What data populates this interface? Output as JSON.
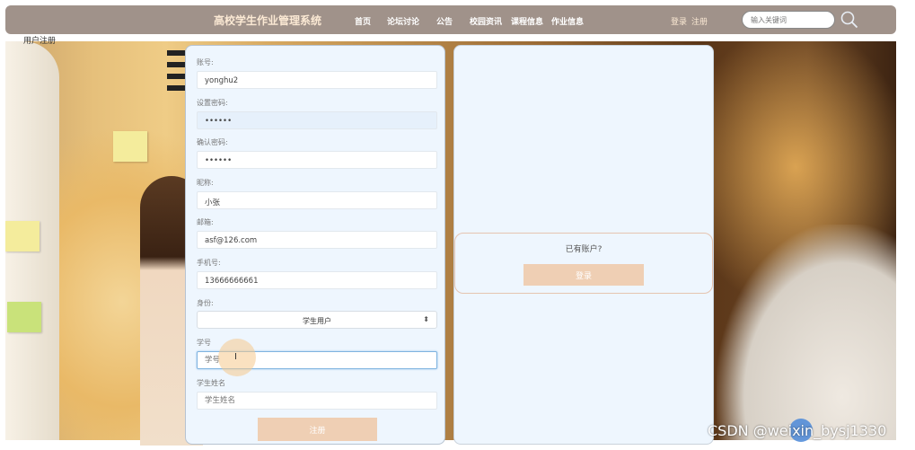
{
  "nav": {
    "site_title": "高校学生作业管理系统",
    "items": [
      "首页",
      "论坛讨论",
      "公告",
      "校园资讯",
      "课程信息",
      "作业信息"
    ],
    "login": "登录",
    "register": "注册",
    "search_placeholder": "输入关键词",
    "search_icon": "search-icon"
  },
  "breadcrumb": "用户注册",
  "form": {
    "fields": [
      {
        "label": "账号:",
        "value": "yonghu2"
      },
      {
        "label": "设置密码:",
        "value": "••••••"
      },
      {
        "label": "确认密码:",
        "value": "••••••"
      },
      {
        "label": "昵称:",
        "value": "小张"
      },
      {
        "label": "邮箱:",
        "value": "asf@126.com"
      },
      {
        "label": "手机号:",
        "value": "13666666661"
      }
    ],
    "identity_label": "身份:",
    "identity_value": "学生用户",
    "student_id_label": "学号",
    "student_id_placeholder": "学号",
    "student_name_label": "学生姓名",
    "student_name_placeholder": "学生姓名",
    "submit_label": "注册"
  },
  "login_box": {
    "question": "已有账户?",
    "button_label": "登录"
  },
  "watermark": "CSDN @weixin_bysj1330",
  "colors": {
    "nav_bg": "#a0928a",
    "button_bg": "#efcfb4",
    "panel_bg": "#eef6fe"
  }
}
